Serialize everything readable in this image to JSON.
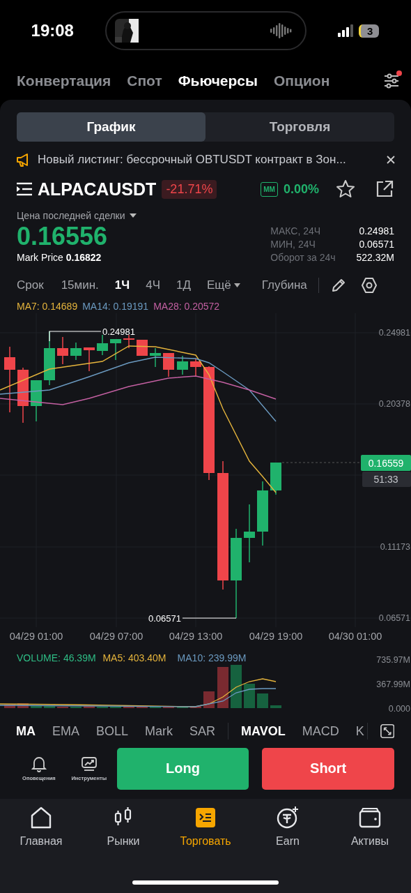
{
  "status_bar": {
    "time": "19:08",
    "battery": "3"
  },
  "top_tabs": [
    {
      "label": "Конвертация",
      "selected": false
    },
    {
      "label": "Спот",
      "selected": false
    },
    {
      "label": "Фьючерсы",
      "selected": true
    },
    {
      "label": "Опцион",
      "selected": false
    }
  ],
  "settings_notification": true,
  "view_tabs": [
    {
      "label": "График",
      "selected": true
    },
    {
      "label": "Торговля",
      "selected": false
    }
  ],
  "notice": {
    "text": "Новый листинг: бессрочный OBTUSDT контракт в Зон..."
  },
  "symbol": {
    "name": "ALPACAUSDT",
    "change": "-21.71%",
    "mm_label": "MM",
    "mm_value": "0.00%"
  },
  "price": {
    "label": "Цена последней сделки",
    "value": "0.16556",
    "mark": "Mark Price **0.16822**"
  },
  "stats": [
    {
      "label": "МАКС, 24Ч",
      "value": "0.24981"
    },
    {
      "label": "МИН, 24Ч",
      "value": "0.06571"
    },
    {
      "label": "Оборот за 24ч",
      "value": "522.32M"
    }
  ],
  "intervals": {
    "label": "Срок",
    "items": [
      {
        "label": "15мин.",
        "selected": false
      },
      {
        "label": "1Ч",
        "selected": true
      },
      {
        "label": "4Ч",
        "selected": false
      },
      {
        "label": "1Д",
        "selected": false
      }
    ],
    "more": "Ещё",
    "depth": "Глубина"
  },
  "ma_legend": [
    {
      "label": "MA7: 0.14689",
      "color": "#e5b43c"
    },
    {
      "label": "MA14: 0.19191",
      "color": "#6b9ac0"
    },
    {
      "label": "MA28: 0.20572",
      "color": "#c460a2"
    }
  ],
  "chart": {
    "y_labels": [
      "0.24981",
      "0.20378",
      "0.11173",
      "0.06571"
    ],
    "x_labels": [
      "04/29 01:00",
      "04/29 07:00",
      "04/29 13:00",
      "04/29 19:00",
      "04/30 01:00"
    ],
    "high_label": "0.24981",
    "low_label": "0.06571",
    "last_price": "0.16559",
    "countdown": "51:33"
  },
  "volume": {
    "legend": [
      {
        "label": "VOLUME: 46.39M",
        "color": "#2ebd85"
      },
      {
        "label": "MA5: 403.40M",
        "color": "#e5b43c"
      },
      {
        "label": "MA10: 239.99M",
        "color": "#6b9ac0"
      }
    ],
    "y_labels": [
      "735.97M",
      "367.99M",
      "0.000"
    ]
  },
  "main_indicators": [
    {
      "label": "MA",
      "selected": true
    },
    {
      "label": "EMA",
      "selected": false
    },
    {
      "label": "BOLL",
      "selected": false
    },
    {
      "label": "Mark",
      "selected": false
    },
    {
      "label": "SAR",
      "selected": false
    }
  ],
  "sub_indicators": [
    {
      "label": "MAVOL",
      "selected": true
    },
    {
      "label": "MACD",
      "selected": false
    },
    {
      "label": "K",
      "selected": false
    }
  ],
  "tools": [
    {
      "label": "Оповещения",
      "kind": "alerts"
    },
    {
      "label": "Инструменты",
      "kind": "tools"
    }
  ],
  "actions": {
    "long": "Long",
    "short": "Short"
  },
  "nav": [
    {
      "label": "Главная",
      "kind": "home",
      "selected": false
    },
    {
      "label": "Рынки",
      "kind": "markets",
      "selected": false
    },
    {
      "label": "Торговать",
      "kind": "trade",
      "selected": true
    },
    {
      "label": "Earn",
      "kind": "earn",
      "selected": false
    },
    {
      "label": "Активы",
      "kind": "assets",
      "selected": false
    }
  ]
}
